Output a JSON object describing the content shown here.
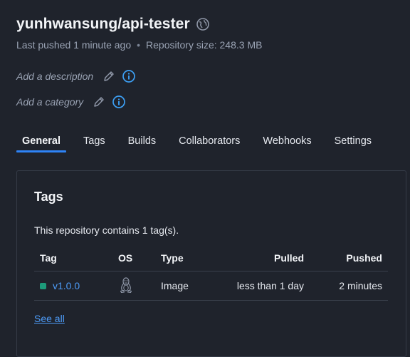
{
  "repo": {
    "name": "yunhwansung/api-tester",
    "last_pushed": "Last pushed 1 minute ago",
    "separator": "•",
    "size": "Repository size: 248.3 MB",
    "visibility_icon": "globe-icon"
  },
  "edit": {
    "description_placeholder": "Add a description",
    "category_placeholder": "Add a category"
  },
  "tabs": [
    {
      "label": "General",
      "active": true
    },
    {
      "label": "Tags"
    },
    {
      "label": "Builds"
    },
    {
      "label": "Collaborators"
    },
    {
      "label": "Webhooks"
    },
    {
      "label": "Settings"
    }
  ],
  "tags_panel": {
    "title": "Tags",
    "summary": "This repository contains 1 tag(s).",
    "columns": {
      "tag": "Tag",
      "os": "OS",
      "type": "Type",
      "pulled": "Pulled",
      "pushed": "Pushed"
    },
    "rows": [
      {
        "tag": "v1.0.0",
        "os_icon": "linux-tux-icon",
        "type": "Image",
        "pulled": "less than 1 day",
        "pushed": "2 minutes",
        "status_color": "#1d9a7a"
      }
    ],
    "see_all": "See all"
  },
  "colors": {
    "background": "#1f232c",
    "accent": "#2e83f6",
    "link": "#4d9bf7",
    "info": "#3da0f5"
  }
}
